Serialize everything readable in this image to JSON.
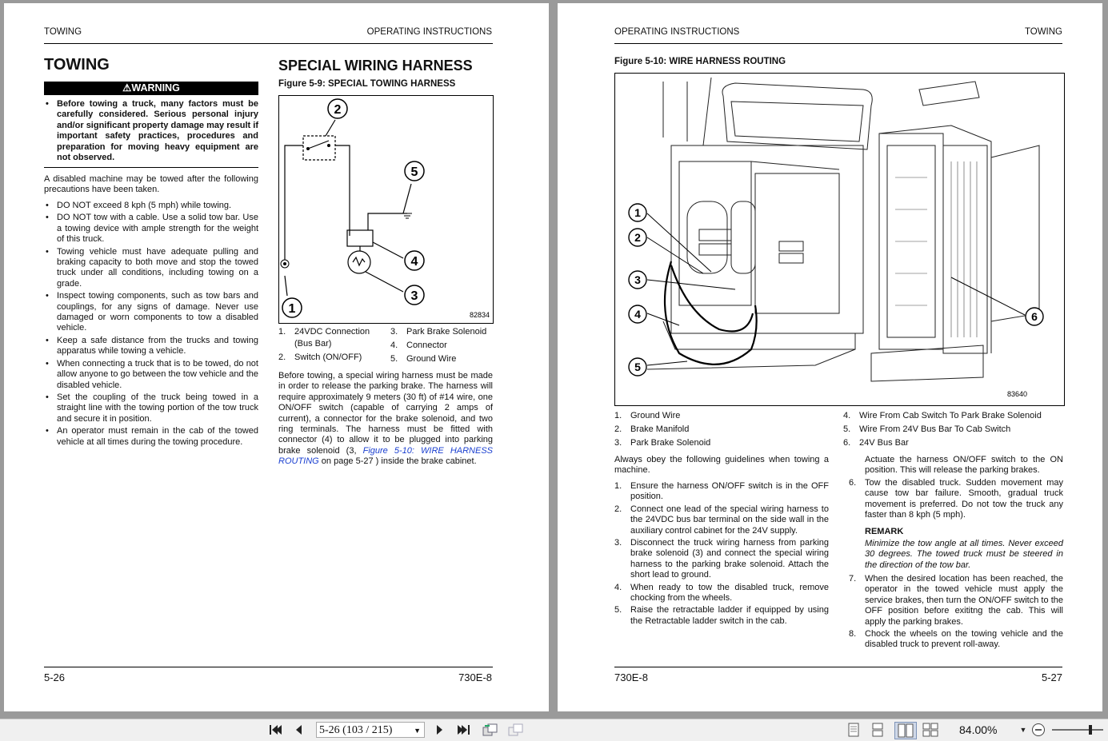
{
  "left_page": {
    "header_left": "TOWING",
    "header_right": "OPERATING INSTRUCTIONS",
    "title": "TOWING",
    "warning_label": "WARNING",
    "warning_text": "Before towing a truck, many factors must be carefully considered. Serious personal injury and/or significant property damage may result if important safety practices, procedures and preparation for moving heavy equipment are not observed.",
    "intro": "A disabled machine may be towed after the following precautions have been taken.",
    "bullets": [
      "DO NOT exceed 8 kph (5 mph) while towing.",
      "DO NOT tow with a cable. Use a solid tow bar. Use a towing device with ample strength for the weight of this truck.",
      "Towing vehicle must have adequate pulling and braking capacity to both move and stop the towed truck under all conditions, including towing on a grade.",
      "Inspect towing components, such as tow bars and couplings, for any signs of damage. Never use damaged or worn components to tow a disabled vehicle.",
      "Keep a safe distance from the trucks and towing apparatus while towing a vehicle.",
      "When connecting a truck that is to be towed, do not allow anyone to go between the tow vehicle and the disabled vehicle.",
      "Set the coupling of the truck being towed in a straight line with the towing portion of the tow truck and secure it in position.",
      "An operator must remain in the cab of the towed vehicle at all times during the towing procedure."
    ],
    "section_title": "SPECIAL WIRING HARNESS",
    "figure_caption": "Figure 5-9: SPECIAL TOWING HARNESS",
    "figure_id": "82834",
    "callouts": [
      "1",
      "2",
      "3",
      "4",
      "5"
    ],
    "legend_left": [
      {
        "num": "1.",
        "text": "24VDC Connection (Bus Bar)"
      },
      {
        "num": "2.",
        "text": "Switch (ON/OFF)"
      }
    ],
    "legend_right": [
      {
        "num": "3.",
        "text": "Park Brake Solenoid"
      },
      {
        "num": "4.",
        "text": "Connector"
      },
      {
        "num": "5.",
        "text": "Ground Wire"
      }
    ],
    "para_before": "Before towing, a special wiring harness must be made in order to release the parking brake. The harness will require approximately 9 meters (30 ft) of #14 wire, one ON/OFF switch (capable of carrying 2 amps of current), a connector for the brake solenoid, and two ring terminals. The harness must be fitted with connector (4) to allow it to be plugged into parking brake solenoid (3, ",
    "para_link": "Figure 5-10: WIRE HARNESS ROUTING",
    "para_after": " on page 5-27 ) inside the brake cabinet.",
    "footer_left": "5-26",
    "footer_right": "730E-8"
  },
  "right_page": {
    "header_left": "OPERATING INSTRUCTIONS",
    "header_right": "TOWING",
    "figure_caption": "Figure 5-10: WIRE HARNESS ROUTING",
    "figure_id": "83640",
    "callouts": [
      "1",
      "2",
      "3",
      "4",
      "5",
      "6"
    ],
    "legend_left": [
      {
        "num": "1.",
        "text": "Ground Wire"
      },
      {
        "num": "2.",
        "text": "Brake Manifold"
      },
      {
        "num": "3.",
        "text": "Park Brake Solenoid"
      }
    ],
    "legend_right": [
      {
        "num": "4.",
        "text": "Wire From Cab Switch To Park Brake Solenoid"
      },
      {
        "num": "5.",
        "text": "Wire From 24V Bus Bar To Cab Switch"
      },
      {
        "num": "6.",
        "text": "24V Bus Bar"
      }
    ],
    "intro": "Always obey the following guidelines when towing a machine.",
    "steps_left": [
      {
        "num": "1.",
        "text": "Ensure the harness ON/OFF switch is in the OFF position."
      },
      {
        "num": "2.",
        "text": "Connect one lead of the special wiring harness to the 24VDC bus bar terminal on the side wall in the auxiliary control cabinet for the 24V supply."
      },
      {
        "num": "3.",
        "text": "Disconnect the truck wiring harness from parking brake solenoid (3) and connect the special wiring harness to the parking brake solenoid. Attach the short lead to ground."
      },
      {
        "num": "4.",
        "text": "When ready to tow the disabled truck, remove chocking from the wheels."
      },
      {
        "num": "5.",
        "text": "Raise the retractable ladder if equipped by using the Retractable ladder switch in the cab."
      }
    ],
    "step5_cont": "Actuate the harness ON/OFF switch to the ON position. This will release the parking brakes.",
    "step6": {
      "num": "6.",
      "text": "Tow the disabled truck. Sudden movement may cause tow bar failure. Smooth, gradual truck movement is preferred. Do not tow the truck any faster than 8 kph (5 mph)."
    },
    "remark_label": "REMARK",
    "remark_text": "Minimize the tow angle at all times. Never exceed 30 degrees. The towed truck must be steered in the direction of the tow bar.",
    "steps_right": [
      {
        "num": "7.",
        "text": "When the desired location has been reached, the operator in the towed vehicle must apply the service brakes, then turn the ON/OFF switch to the OFF position before exititng the cab. This will apply the parking brakes."
      },
      {
        "num": "8.",
        "text": "Chock the wheels on the towing vehicle and the disabled truck to prevent roll-away."
      }
    ],
    "footer_left": "730E-8",
    "footer_right": "5-27"
  },
  "toolbar": {
    "page_field": "5-26 (103 / 215)",
    "zoom": "84.00%",
    "icons": [
      "first-page-icon",
      "prev-page-icon",
      "next-page-icon",
      "last-page-icon",
      "go-back-view-icon",
      "go-forward-view-icon",
      "single-page-icon",
      "continuous-icon",
      "facing-icon",
      "continuous-facing-icon",
      "zoom-out-icon",
      "zoom-slider"
    ]
  }
}
